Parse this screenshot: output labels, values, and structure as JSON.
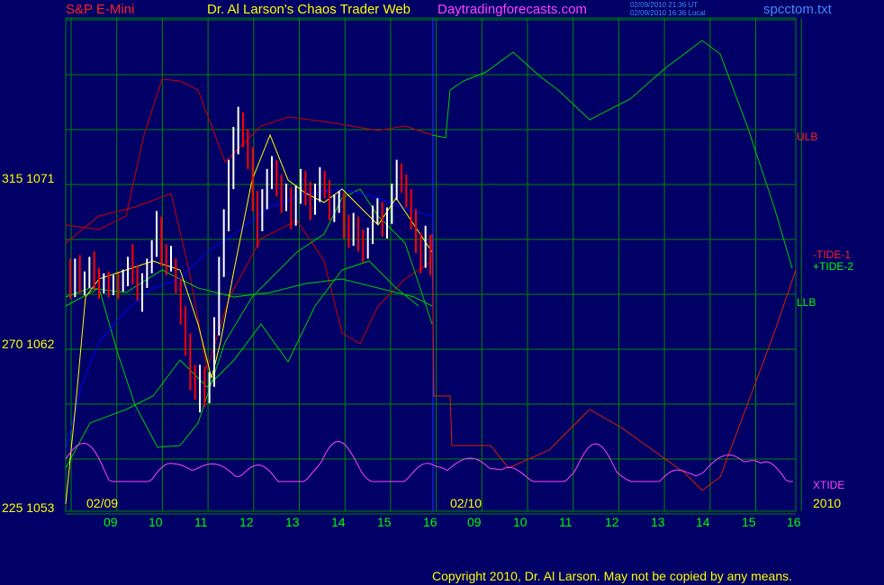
{
  "header": {
    "market": "S&P E-Mini",
    "title": "Dr. Al Larson's Chaos Trader Web",
    "site": "Daytradingforecasts.com",
    "stamp_ut": "02/09/2010 21:36 UT",
    "stamp_local": "02/09/2010 16:36 Local",
    "file": "spcctom.txt"
  },
  "copyright": "Copyright 2010, Dr. Al Larson. May not be copied by any means.",
  "colors": {
    "background": "#000066",
    "grid": "#008800",
    "price_up": "#ffffff",
    "price_down": "#ff0000",
    "band": "#cc0000",
    "tide1": "#dd2200",
    "tide2": "#00cc00",
    "xtide": "#ff44ff",
    "mavg": "#0000ff",
    "ema": "#ffff00",
    "axis_text": "#ffff00",
    "time_text": "#00ff00"
  },
  "chart_data": {
    "type": "line",
    "y_ticks": [
      {
        "label": "315  1071",
        "value": 1071
      },
      {
        "label": "270  1062",
        "value": 1062
      },
      {
        "label": "225  1053",
        "value": 1053
      }
    ],
    "ylim": [
      1053,
      1075
    ],
    "x_hours_day1": [
      "09",
      "10",
      "11",
      "12",
      "13",
      "14",
      "15",
      "16"
    ],
    "x_hours_day2": [
      "09",
      "10",
      "11",
      "12",
      "13",
      "14",
      "15",
      "16"
    ],
    "date_labels": [
      "02/09",
      "02/10",
      "2010"
    ],
    "series_labels": {
      "ulb": "ULB",
      "tide1": "-TIDE-1",
      "tide2": "+TIDE-2",
      "llb": "LLB",
      "xtide": "XTIDE"
    },
    "price_bars": [
      [
        1066.4,
        1065.1,
        1066.8,
        1064.6
      ],
      [
        1065.1,
        1066.2,
        1066.8,
        1064.7
      ],
      [
        1066.2,
        1065.3,
        1067.0,
        1064.9
      ],
      [
        1065.3,
        1065.5,
        1066.1,
        1064.8
      ],
      [
        1065.5,
        1066.4,
        1066.9,
        1065.2
      ],
      [
        1066.4,
        1065.8,
        1067.2,
        1065.1
      ],
      [
        1065.8,
        1065.2,
        1066.3,
        1064.6
      ],
      [
        1065.2,
        1065.6,
        1066.0,
        1064.9
      ],
      [
        1065.6,
        1065.0,
        1066.1,
        1064.7
      ],
      [
        1065.0,
        1065.4,
        1065.9,
        1064.8
      ],
      [
        1065.4,
        1065.2,
        1066.0,
        1064.6
      ],
      [
        1065.2,
        1065.7,
        1066.2,
        1065.0
      ],
      [
        1065.7,
        1066.3,
        1066.9,
        1065.3
      ],
      [
        1066.3,
        1065.9,
        1067.6,
        1065.4
      ],
      [
        1065.9,
        1065.1,
        1066.4,
        1064.5
      ],
      [
        1065.1,
        1065.6,
        1066.0,
        1063.9
      ],
      [
        1065.6,
        1066.4,
        1066.8,
        1065.2
      ],
      [
        1066.4,
        1067.3,
        1067.8,
        1066.0
      ],
      [
        1067.3,
        1068.8,
        1069.4,
        1066.9
      ],
      [
        1068.8,
        1067.2,
        1069.1,
        1066.4
      ],
      [
        1067.2,
        1066.6,
        1067.6,
        1065.9
      ],
      [
        1066.6,
        1067.1,
        1067.5,
        1066.1
      ],
      [
        1066.3,
        1065.4,
        1066.8,
        1064.9
      ],
      [
        1065.4,
        1063.8,
        1065.7,
        1063.2
      ],
      [
        1063.8,
        1062.2,
        1064.2,
        1061.5
      ],
      [
        1062.2,
        1060.6,
        1062.7,
        1059.6
      ],
      [
        1060.6,
        1059.9,
        1061.0,
        1059.1
      ],
      [
        1059.9,
        1060.5,
        1061.0,
        1058.4
      ],
      [
        1060.5,
        1059.2,
        1060.9,
        1058.7
      ],
      [
        1059.2,
        1060.1,
        1060.6,
        1058.9
      ],
      [
        1060.1,
        1063.0,
        1063.6,
        1059.8
      ],
      [
        1063.0,
        1066.4,
        1066.9,
        1062.6
      ],
      [
        1066.4,
        1068.9,
        1069.5,
        1065.8
      ],
      [
        1068.9,
        1071.4,
        1072.2,
        1068.3
      ],
      [
        1071.4,
        1073.2,
        1074.0,
        1070.6
      ],
      [
        1073.2,
        1074.1,
        1075.1,
        1072.5
      ],
      [
        1074.1,
        1073.5,
        1074.8,
        1072.9
      ],
      [
        1073.5,
        1072.6,
        1073.9,
        1071.7
      ],
      [
        1072.6,
        1070.1,
        1072.9,
        1069.4
      ],
      [
        1070.1,
        1068.9,
        1070.5,
        1067.4
      ],
      [
        1068.9,
        1070.0,
        1070.6,
        1068.3
      ],
      [
        1070.0,
        1071.1,
        1071.7,
        1069.5
      ],
      [
        1071.1,
        1071.8,
        1072.4,
        1070.6
      ],
      [
        1071.8,
        1070.9,
        1072.2,
        1070.2
      ],
      [
        1070.9,
        1069.9,
        1071.4,
        1069.3
      ],
      [
        1069.9,
        1070.4,
        1070.9,
        1069.4
      ],
      [
        1070.4,
        1069.0,
        1070.7,
        1068.4
      ],
      [
        1069.0,
        1070.2,
        1070.8,
        1068.6
      ],
      [
        1070.2,
        1071.1,
        1071.7,
        1069.8
      ],
      [
        1071.1,
        1070.6,
        1071.6,
        1069.7
      ],
      [
        1070.6,
        1069.7,
        1071.0,
        1068.9
      ],
      [
        1069.7,
        1070.4,
        1070.9,
        1069.2
      ],
      [
        1070.4,
        1071.2,
        1071.8,
        1069.9
      ],
      [
        1071.2,
        1070.7,
        1071.6,
        1070.1
      ],
      [
        1070.7,
        1069.4,
        1071.1,
        1068.9
      ],
      [
        1069.4,
        1069.9,
        1070.3,
        1068.8
      ],
      [
        1069.9,
        1070.1,
        1070.5,
        1069.3
      ],
      [
        1070.1,
        1068.7,
        1070.4,
        1067.9
      ],
      [
        1068.7,
        1068.0,
        1069.2,
        1067.4
      ],
      [
        1068.0,
        1068.8,
        1069.3,
        1067.5
      ],
      [
        1068.8,
        1067.9,
        1069.1,
        1067.2
      ],
      [
        1067.9,
        1067.1,
        1068.4,
        1066.6
      ],
      [
        1067.1,
        1068.0,
        1068.5,
        1066.8
      ],
      [
        1068.0,
        1069.2,
        1069.7,
        1067.6
      ],
      [
        1069.2,
        1069.6,
        1070.1,
        1068.7
      ],
      [
        1069.6,
        1068.5,
        1069.9,
        1068.0
      ],
      [
        1068.5,
        1069.1,
        1069.6,
        1067.9
      ],
      [
        1069.1,
        1070.4,
        1070.9,
        1068.7
      ],
      [
        1070.4,
        1071.6,
        1072.2,
        1070.0
      ],
      [
        1071.6,
        1071.0,
        1072.0,
        1070.4
      ],
      [
        1071.0,
        1070.2,
        1071.4,
        1069.6
      ],
      [
        1070.2,
        1069.1,
        1070.6,
        1068.4
      ],
      [
        1069.1,
        1067.8,
        1069.5,
        1067.1
      ],
      [
        1067.8,
        1066.8,
        1068.2,
        1066.0
      ],
      [
        1066.8,
        1067.4,
        1068.6,
        1066.3
      ],
      [
        1067.4,
        1066.6,
        1068.1,
        1065.9
      ]
    ]
  }
}
